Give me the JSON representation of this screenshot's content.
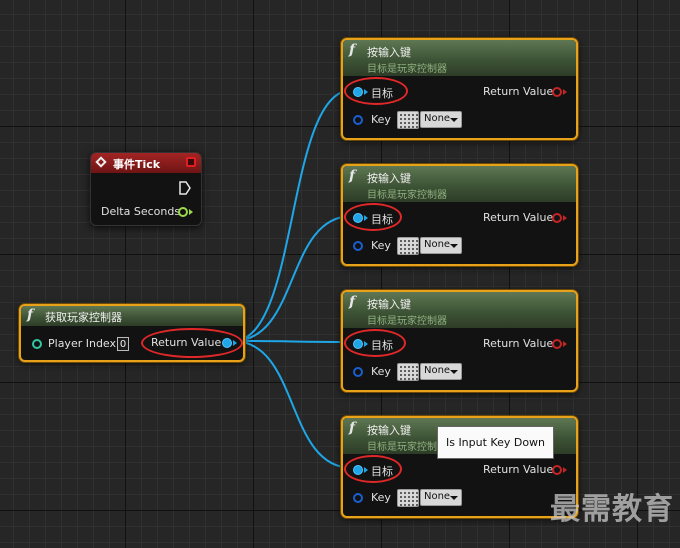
{
  "event_node": {
    "title": "事件Tick",
    "output_label": "Delta Seconds"
  },
  "get_controller_node": {
    "title": "获取玩家控制器",
    "input_label": "Player Index",
    "input_value": "0",
    "output_label": "Return Value"
  },
  "key_nodes": [
    {
      "title": "按输入键",
      "subtitle": "目标是玩家控制器",
      "target_label": "目标",
      "return_label": "Return Value",
      "key_label": "Key",
      "key_value": "None"
    },
    {
      "title": "按输入键",
      "subtitle": "目标是玩家控制器",
      "target_label": "目标",
      "return_label": "Return Value",
      "key_label": "Key",
      "key_value": "None"
    },
    {
      "title": "按输入键",
      "subtitle": "目标是玩家控制器",
      "target_label": "目标",
      "return_label": "Return Value",
      "key_label": "Key",
      "key_value": "None"
    },
    {
      "title": "按输入键",
      "subtitle": "目标是玩家控制器",
      "target_label": "目标",
      "return_label": "Return Value",
      "key_label": "Key",
      "key_value": "None"
    }
  ],
  "tooltip": "Is Input Key Down",
  "watermark": "最需教育",
  "colors": {
    "selection": "#e8a21a",
    "wire": "#1fa6e6",
    "annotation": "#e02828",
    "event_header": "#8b1c1c",
    "function_header": "#3e5436"
  }
}
